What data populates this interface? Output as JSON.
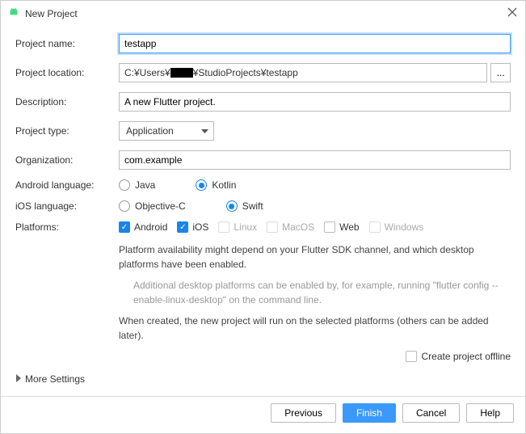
{
  "window": {
    "title": "New Project"
  },
  "labels": {
    "project_name": "Project name:",
    "project_location": "Project location:",
    "description": "Description:",
    "project_type": "Project type:",
    "organization": "Organization:",
    "android_language": "Android language:",
    "ios_language": "iOS language:",
    "platforms": "Platforms:"
  },
  "fields": {
    "project_name": "testapp",
    "project_location_prefix": "C:¥Users¥",
    "project_location_suffix": "¥StudioProjects¥testapp",
    "description": "A new Flutter project.",
    "project_type": "Application",
    "organization": "com.example",
    "browse": "..."
  },
  "android_lang": {
    "java": "Java",
    "kotlin": "Kotlin"
  },
  "ios_lang": {
    "objc": "Objective-C",
    "swift": "Swift"
  },
  "platforms": {
    "android": "Android",
    "ios": "iOS",
    "linux": "Linux",
    "macos": "MacOS",
    "web": "Web",
    "windows": "Windows"
  },
  "info": {
    "availability": "Platform availability might depend on your Flutter SDK channel, and which desktop platforms have been enabled.",
    "additional": "Additional desktop platforms can be enabled by, for example, running \"flutter config --enable-linux-desktop\" on the command line.",
    "when_created": "When created, the new project will run on the selected platforms (others can be added later)."
  },
  "offline_label": "Create project offline",
  "more_settings": "More Settings",
  "buttons": {
    "previous": "Previous",
    "finish": "Finish",
    "cancel": "Cancel",
    "help": "Help"
  }
}
